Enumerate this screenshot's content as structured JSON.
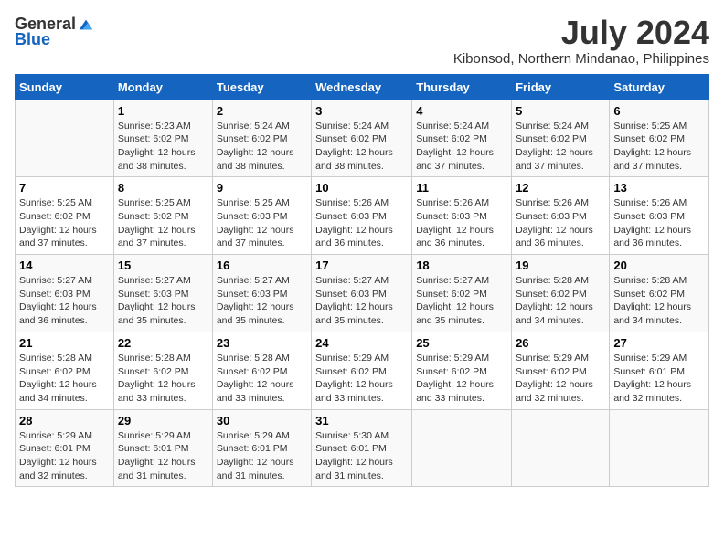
{
  "logo": {
    "general": "General",
    "blue": "Blue"
  },
  "title": {
    "month_year": "July 2024",
    "location": "Kibonsod, Northern Mindanao, Philippines"
  },
  "header_days": [
    "Sunday",
    "Monday",
    "Tuesday",
    "Wednesday",
    "Thursday",
    "Friday",
    "Saturday"
  ],
  "weeks": [
    [
      {
        "day": "",
        "info": ""
      },
      {
        "day": "1",
        "info": "Sunrise: 5:23 AM\nSunset: 6:02 PM\nDaylight: 12 hours\nand 38 minutes."
      },
      {
        "day": "2",
        "info": "Sunrise: 5:24 AM\nSunset: 6:02 PM\nDaylight: 12 hours\nand 38 minutes."
      },
      {
        "day": "3",
        "info": "Sunrise: 5:24 AM\nSunset: 6:02 PM\nDaylight: 12 hours\nand 38 minutes."
      },
      {
        "day": "4",
        "info": "Sunrise: 5:24 AM\nSunset: 6:02 PM\nDaylight: 12 hours\nand 37 minutes."
      },
      {
        "day": "5",
        "info": "Sunrise: 5:24 AM\nSunset: 6:02 PM\nDaylight: 12 hours\nand 37 minutes."
      },
      {
        "day": "6",
        "info": "Sunrise: 5:25 AM\nSunset: 6:02 PM\nDaylight: 12 hours\nand 37 minutes."
      }
    ],
    [
      {
        "day": "7",
        "info": "Sunrise: 5:25 AM\nSunset: 6:02 PM\nDaylight: 12 hours\nand 37 minutes."
      },
      {
        "day": "8",
        "info": "Sunrise: 5:25 AM\nSunset: 6:02 PM\nDaylight: 12 hours\nand 37 minutes."
      },
      {
        "day": "9",
        "info": "Sunrise: 5:25 AM\nSunset: 6:03 PM\nDaylight: 12 hours\nand 37 minutes."
      },
      {
        "day": "10",
        "info": "Sunrise: 5:26 AM\nSunset: 6:03 PM\nDaylight: 12 hours\nand 36 minutes."
      },
      {
        "day": "11",
        "info": "Sunrise: 5:26 AM\nSunset: 6:03 PM\nDaylight: 12 hours\nand 36 minutes."
      },
      {
        "day": "12",
        "info": "Sunrise: 5:26 AM\nSunset: 6:03 PM\nDaylight: 12 hours\nand 36 minutes."
      },
      {
        "day": "13",
        "info": "Sunrise: 5:26 AM\nSunset: 6:03 PM\nDaylight: 12 hours\nand 36 minutes."
      }
    ],
    [
      {
        "day": "14",
        "info": "Sunrise: 5:27 AM\nSunset: 6:03 PM\nDaylight: 12 hours\nand 36 minutes."
      },
      {
        "day": "15",
        "info": "Sunrise: 5:27 AM\nSunset: 6:03 PM\nDaylight: 12 hours\nand 35 minutes."
      },
      {
        "day": "16",
        "info": "Sunrise: 5:27 AM\nSunset: 6:03 PM\nDaylight: 12 hours\nand 35 minutes."
      },
      {
        "day": "17",
        "info": "Sunrise: 5:27 AM\nSunset: 6:03 PM\nDaylight: 12 hours\nand 35 minutes."
      },
      {
        "day": "18",
        "info": "Sunrise: 5:27 AM\nSunset: 6:02 PM\nDaylight: 12 hours\nand 35 minutes."
      },
      {
        "day": "19",
        "info": "Sunrise: 5:28 AM\nSunset: 6:02 PM\nDaylight: 12 hours\nand 34 minutes."
      },
      {
        "day": "20",
        "info": "Sunrise: 5:28 AM\nSunset: 6:02 PM\nDaylight: 12 hours\nand 34 minutes."
      }
    ],
    [
      {
        "day": "21",
        "info": "Sunrise: 5:28 AM\nSunset: 6:02 PM\nDaylight: 12 hours\nand 34 minutes."
      },
      {
        "day": "22",
        "info": "Sunrise: 5:28 AM\nSunset: 6:02 PM\nDaylight: 12 hours\nand 33 minutes."
      },
      {
        "day": "23",
        "info": "Sunrise: 5:28 AM\nSunset: 6:02 PM\nDaylight: 12 hours\nand 33 minutes."
      },
      {
        "day": "24",
        "info": "Sunrise: 5:29 AM\nSunset: 6:02 PM\nDaylight: 12 hours\nand 33 minutes."
      },
      {
        "day": "25",
        "info": "Sunrise: 5:29 AM\nSunset: 6:02 PM\nDaylight: 12 hours\nand 33 minutes."
      },
      {
        "day": "26",
        "info": "Sunrise: 5:29 AM\nSunset: 6:02 PM\nDaylight: 12 hours\nand 32 minutes."
      },
      {
        "day": "27",
        "info": "Sunrise: 5:29 AM\nSunset: 6:01 PM\nDaylight: 12 hours\nand 32 minutes."
      }
    ],
    [
      {
        "day": "28",
        "info": "Sunrise: 5:29 AM\nSunset: 6:01 PM\nDaylight: 12 hours\nand 32 minutes."
      },
      {
        "day": "29",
        "info": "Sunrise: 5:29 AM\nSunset: 6:01 PM\nDaylight: 12 hours\nand 31 minutes."
      },
      {
        "day": "30",
        "info": "Sunrise: 5:29 AM\nSunset: 6:01 PM\nDaylight: 12 hours\nand 31 minutes."
      },
      {
        "day": "31",
        "info": "Sunrise: 5:30 AM\nSunset: 6:01 PM\nDaylight: 12 hours\nand 31 minutes."
      },
      {
        "day": "",
        "info": ""
      },
      {
        "day": "",
        "info": ""
      },
      {
        "day": "",
        "info": ""
      }
    ]
  ]
}
